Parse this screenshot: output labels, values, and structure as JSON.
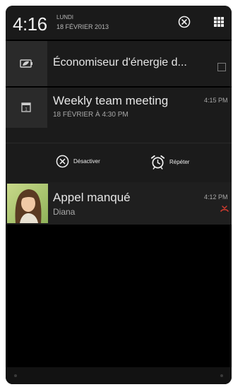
{
  "status": {
    "time": "4:16",
    "day": "LUNDI",
    "date": "18 FÉVRIER 2013"
  },
  "header_icons": {
    "clear": "close-circle-icon",
    "grid": "grid-icon"
  },
  "notifications": [
    {
      "icon": "battery-leaf-icon",
      "title": "Économiseur d'énergie d..."
    },
    {
      "icon": "calendar-icon",
      "title": "Weekly team meeting",
      "subtitle": "18 FÉVRIER À 4:30 PM",
      "time": "4:15 PM",
      "actions": [
        {
          "label": "Désactiver",
          "icon": "close-circle-icon"
        },
        {
          "label": "Répéter",
          "icon": "alarm-clock-icon"
        }
      ]
    },
    {
      "icon": "contact-photo",
      "title": "Appel manqué",
      "subtitle": "Diana",
      "time": "4:12 PM",
      "status_icon": "missed-call-icon"
    }
  ],
  "colors": {
    "background": "#000000",
    "row_bg": "#1b1b1b",
    "icon_cell_bg": "#2a2a2a",
    "missed_call": "#d23b2f"
  }
}
